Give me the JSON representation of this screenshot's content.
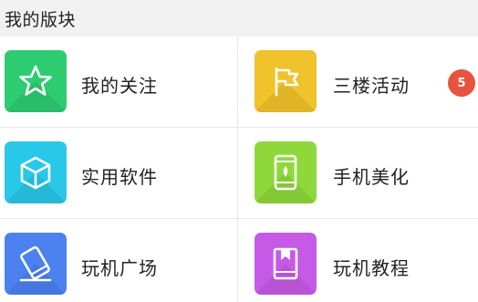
{
  "header": {
    "title": "我的版块"
  },
  "items": [
    {
      "label": "我的关注",
      "icon": "star-icon",
      "color": "#2ecc71"
    },
    {
      "label": "三楼活动",
      "icon": "flag-icon",
      "color": "#f0c22b",
      "badge": "5"
    },
    {
      "label": "实用软件",
      "icon": "cube-icon",
      "color": "#29c8e8"
    },
    {
      "label": "手机美化",
      "icon": "phone-icon",
      "color": "#8fd83b"
    },
    {
      "label": "玩机广场",
      "icon": "tablet-pen-icon",
      "color": "#4b82ef"
    },
    {
      "label": "玩机教程",
      "icon": "book-icon",
      "color": "#c65ae6"
    }
  ],
  "colors": {
    "badge": "#e8533f",
    "header_bg": "#f1f1f1"
  }
}
